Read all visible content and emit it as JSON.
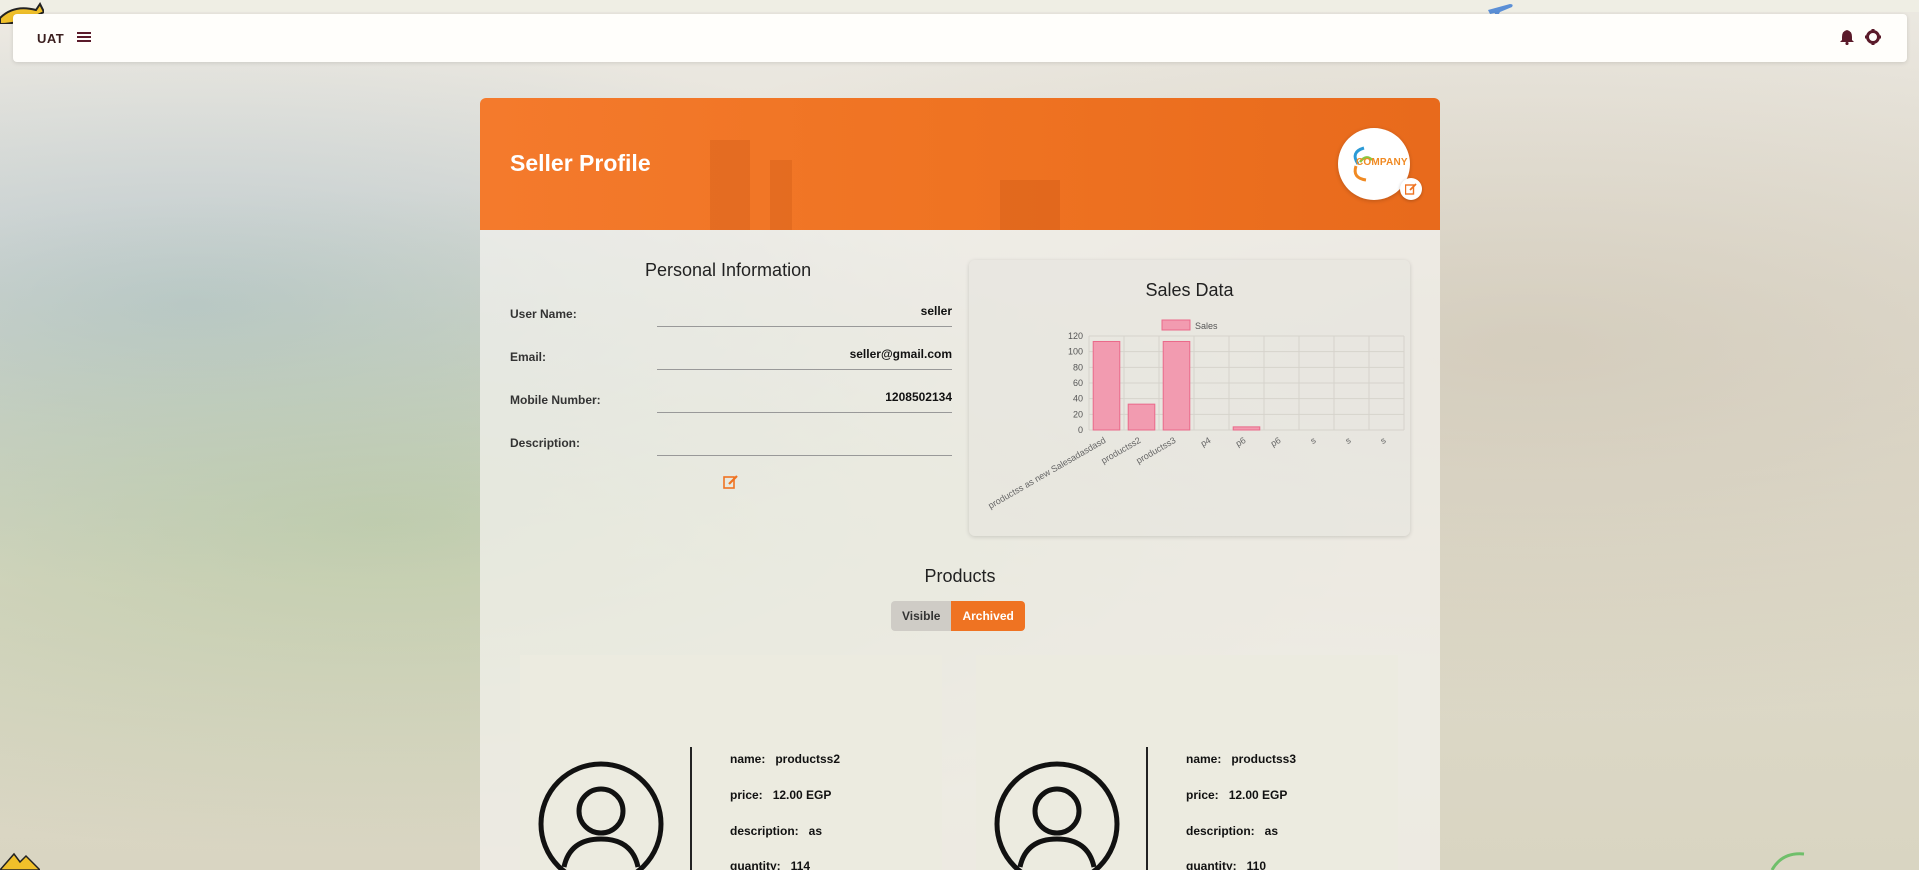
{
  "navbar": {
    "brand": "UAT"
  },
  "header": {
    "title": "Seller Profile",
    "logo_text": "COMPANY"
  },
  "personal_info": {
    "title": "Personal Information",
    "fields": [
      {
        "label": "User Name:",
        "value": "seller"
      },
      {
        "label": "Email:",
        "value": "seller@gmail.com"
      },
      {
        "label": "Mobile Number:",
        "value": "1208502134"
      },
      {
        "label": "Description:",
        "value": ""
      }
    ]
  },
  "sales": {
    "title": "Sales Data"
  },
  "chart_data": {
    "type": "bar",
    "title": "Sales Data",
    "legend": "top",
    "series": [
      {
        "name": "Sales",
        "values": [
          113,
          33,
          113,
          0,
          4,
          0,
          0,
          0,
          0
        ]
      }
    ],
    "categories": [
      "productss as new Salesadasdasd",
      "productss2",
      "productss3",
      "p4",
      "p6",
      "p6",
      "s",
      "s",
      "s"
    ],
    "ylim": [
      0,
      120
    ],
    "yticks": [
      0,
      20,
      40,
      60,
      80,
      100,
      120
    ],
    "grid": true,
    "colors": {
      "bar_fill": "#f29bb0",
      "bar_stroke": "#ea6a8a"
    }
  },
  "products": {
    "title": "Products",
    "tabs": {
      "visible": "Visible",
      "archived": "Archived",
      "active": "archived"
    },
    "items": [
      {
        "name_label": "name:",
        "name": "productss2",
        "price_label": "price:",
        "price": "12.00 EGP",
        "desc_label": "description:",
        "description": "as",
        "qty_label": "quantity:",
        "quantity": "114"
      },
      {
        "name_label": "name:",
        "name": "productss3",
        "price_label": "price:",
        "price": "12.00 EGP",
        "desc_label": "description:",
        "description": "as",
        "qty_label": "quantity:",
        "quantity": "110"
      }
    ]
  },
  "colors": {
    "accent": "#ef7322",
    "navbar": "#fffefb",
    "icon": "#5a1a2a"
  }
}
